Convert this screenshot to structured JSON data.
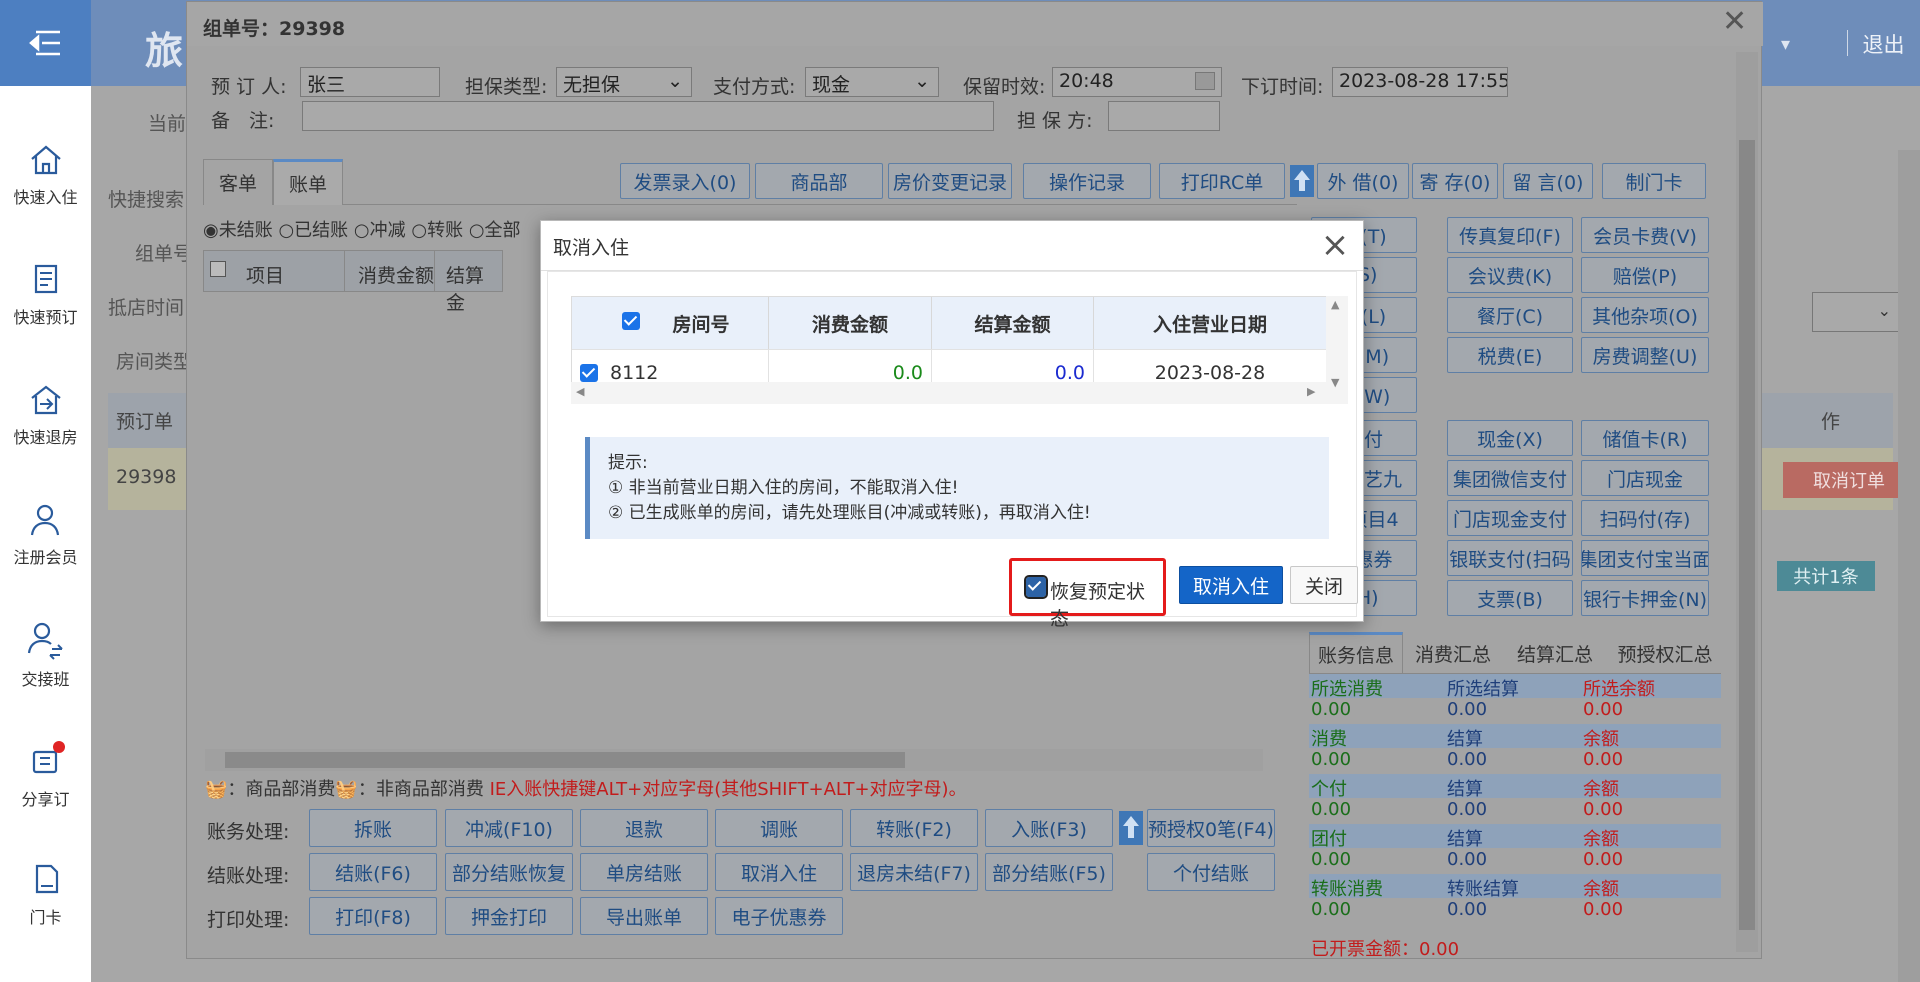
{
  "sidebar": {
    "items": [
      {
        "label": "快速入住"
      },
      {
        "label": "快速预订"
      },
      {
        "label": "快速退房"
      },
      {
        "label": "注册会员"
      },
      {
        "label": "交接班"
      },
      {
        "label": "分享订"
      },
      {
        "label": "门卡"
      }
    ]
  },
  "topbar": {
    "title": "旅",
    "logout": "退出"
  },
  "background": {
    "current": "当前",
    "quick_search": "快捷搜索",
    "group": "组单号",
    "arrival": "抵店时间",
    "room_type": "房间类型",
    "booking_col": "预订单",
    "booking_id": "29398",
    "action_col": "作",
    "cancel_order": "取消订单",
    "total": "共计1条"
  },
  "window": {
    "title": "组单号：29398",
    "form": {
      "booker_label": "预 订 人:",
      "booker": "张三",
      "guarantee_label": "担保类型:",
      "guarantee": "无担保",
      "pay_label": "支付方式:",
      "pay": "现金",
      "hold_label": "保留时效:",
      "hold": "20:48",
      "order_time_label": "下订时间:",
      "order_time": "2023-08-28 17:55:3",
      "remark_label": "备　注:",
      "guarantor_label": "担 保 方:"
    },
    "tabs": [
      "客单",
      "账单"
    ],
    "toolbar": [
      "发票录入(0)",
      "商品部",
      "房价变更记录",
      "操作记录",
      "打印RC单",
      "外 借(0)",
      "寄 存(0)",
      "留 言(0)",
      "制门卡"
    ],
    "filters": [
      "未结账",
      "已结账",
      "冲减",
      "转账",
      "全部"
    ],
    "grid_headers": [
      "项目",
      "消费金额",
      "结算金"
    ],
    "right_buttons": [
      "费(T)",
      "传真复印(F)",
      "会员卡费(V)",
      "(S)",
      "会议费(K)",
      "赔偿(P)",
      "费(L)",
      "餐厅(C)",
      "其他杂项(O)",
      "券(M)",
      "税费(E)",
      "房费调整(U)",
      "券(W)",
      "支付",
      "现金(X)",
      "储值卡(R)",
      "单（艺九",
      "集团微信支付",
      "门店现金",
      "单项目4",
      "门店现金支付",
      "扫码付(存)",
      "优惠券",
      "银联支付(扫码",
      "集团支付宝当面",
      "(H)",
      "支票(B)",
      "银行卡押金(N)"
    ],
    "summary_tabs": [
      "账务信息",
      "消费汇总",
      "结算汇总",
      "预授权汇总"
    ],
    "summary": [
      {
        "a": "所选消费",
        "b": "所选结算",
        "c": "所选余额"
      },
      {
        "a": "消费",
        "b": "结算",
        "c": "余额"
      },
      {
        "a": "个付",
        "b": "结算",
        "c": "余额"
      },
      {
        "a": "团付",
        "b": "结算",
        "c": "余额"
      },
      {
        "a": "转账消费",
        "b": "转账结算",
        "c": "余额"
      }
    ],
    "zero": "0.00",
    "invoiced": "已开票金额：0.00",
    "legend_goods": "：商品部消费",
    "legend_nongoods": "：非商品部消费",
    "shortcut_tip": "IE入账快捷键ALT+对应字母(其他SHIFT+ALT+对应字母)。",
    "row_labels": [
      "账务处理:",
      "结账处理:",
      "打印处理:"
    ],
    "acct_buttons": [
      "拆账",
      "冲减(F10)",
      "退款",
      "调账",
      "转账(F2)",
      "入账(F3)",
      "预授权0笔(F4)"
    ],
    "settle_buttons": [
      "结账(F6)",
      "部分结账恢复",
      "单房结账",
      "取消入住",
      "退房未结(F7)",
      "部分结账(F5)",
      "个付结账"
    ],
    "print_buttons": [
      "打印(F8)",
      "押金打印",
      "导出账单",
      "电子优惠券"
    ]
  },
  "dialog": {
    "title": "取消入住",
    "headers": [
      "房间号",
      "消费金额",
      "结算金额",
      "入住营业日期"
    ],
    "row": {
      "room": "8112",
      "consume": "0.0",
      "settle": "0.0",
      "date": "2023-08-28"
    },
    "tip_title": "提示:",
    "tip1": "① 非当前营业日期入住的房间，不能取消入住!",
    "tip2": "② 已生成账单的房间，请先处理账目(冲减或转账)，再取消入住!",
    "restore_label": "恢复预定状态",
    "confirm": "取消入住",
    "close": "关闭"
  }
}
